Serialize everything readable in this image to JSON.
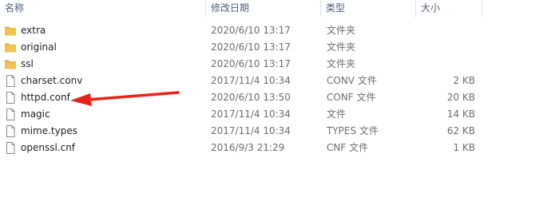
{
  "columns": {
    "name": "名称",
    "date": "修改日期",
    "type": "类型",
    "size": "大小"
  },
  "files": [
    {
      "name": "extra",
      "date": "2020/6/10 13:17",
      "type": "文件夹",
      "size": "",
      "icon": "folder-icon"
    },
    {
      "name": "original",
      "date": "2020/6/10 13:17",
      "type": "文件夹",
      "size": "",
      "icon": "folder-icon"
    },
    {
      "name": "ssl",
      "date": "2020/6/10 13:17",
      "type": "文件夹",
      "size": "",
      "icon": "folder-icon"
    },
    {
      "name": "charset.conv",
      "date": "2017/11/4 10:34",
      "type": "CONV 文件",
      "size": "2 KB",
      "icon": "file-icon"
    },
    {
      "name": "httpd.conf",
      "date": "2020/6/10 13:50",
      "type": "CONF 文件",
      "size": "20 KB",
      "icon": "file-icon"
    },
    {
      "name": "magic",
      "date": "2017/11/4 10:34",
      "type": "文件",
      "size": "14 KB",
      "icon": "file-icon"
    },
    {
      "name": "mime.types",
      "date": "2017/11/4 10:34",
      "type": "TYPES 文件",
      "size": "62 KB",
      "icon": "file-icon"
    },
    {
      "name": "openssl.cnf",
      "date": "2016/9/3 21:29",
      "type": "CNF 文件",
      "size": "1 KB",
      "icon": "file-icon"
    }
  ],
  "annotation": {
    "icon": "red-arrow-icon",
    "color": "#e8231c"
  },
  "colors": {
    "folder": "#f3c24e",
    "folder_dark": "#e0a72b",
    "header_text": "#4c607a"
  }
}
